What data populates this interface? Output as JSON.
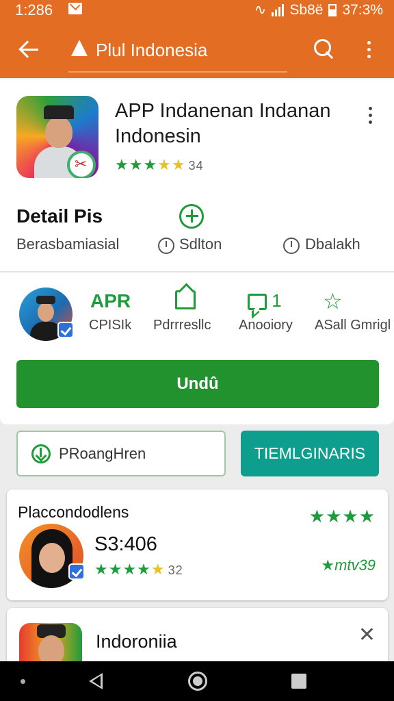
{
  "status_bar": {
    "time": "1:286",
    "right_text": "Sb8ë",
    "battery": "37:3%"
  },
  "app_bar": {
    "title": "Plul Indonesia"
  },
  "app": {
    "name": "APP Indanenan Indanan Indonesin",
    "rating_count": "34",
    "rating_stars": 3.5,
    "detail_title": "Detail Pis",
    "meta": [
      "Berasbamiasial",
      "Sdlton",
      "Dbalakh"
    ]
  },
  "developer": {
    "stats": [
      {
        "top": "APR",
        "bottom": "CPISIk",
        "top_kind": "text"
      },
      {
        "top": "",
        "bottom": "Pdrrresllc",
        "top_kind": "home-icon"
      },
      {
        "top": "1",
        "bottom": "Anooiory",
        "top_kind": "chat-icon"
      },
      {
        "top": "",
        "bottom": "ASall Gmrigl",
        "top_kind": "star-outline-icon"
      }
    ]
  },
  "download_button": "Undû",
  "actions": {
    "outline_label": "PRoangHren",
    "teal_label": "TIEMLGINARIS"
  },
  "recommendations": [
    {
      "title": "Placcondodlens",
      "value": "S3:406",
      "rating_count": "32",
      "right_text": "★mtv39"
    },
    {
      "title": "Indoroniia"
    }
  ],
  "colors": {
    "app_bar": "#e36d23",
    "accent_green": "#22922f",
    "teal": "#0e9e8e",
    "star_yellow": "#e6c229"
  }
}
